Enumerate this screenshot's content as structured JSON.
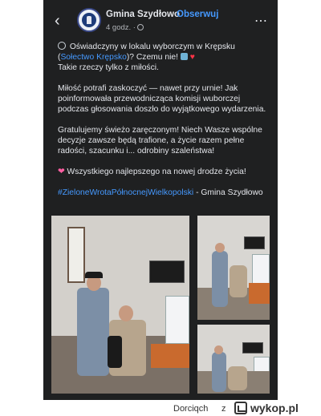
{
  "post": {
    "page_name": "Gmina Szydłowo",
    "separator": "·",
    "follow_label": "Obserwuj",
    "time": "4 godz. ·",
    "paragraphs": {
      "p1_a": " Oświadczyny w lokalu wyborczym w Krępsku (",
      "p1_link": "Sołectwo Krępsko",
      "p1_b": ")? Czemu nie! ",
      "p1_c": "Takie rzeczy tylko z miłości.",
      "p2": "Miłość potrafi zaskoczyć — nawet przy urnie! Jak poinformowała przewodnicząca komisji wuborczej podczas głosowania doszło do wyjątkowego wydarzenia.",
      "p3": "Gratulujemy świeżo zaręczonym! Niech Wasze wspólne decyzje zawsze będą trafione, a życie razem pełne radości, szacunku i... odrobiny szaleństwa!",
      "p4": " Wszystkiego najlepszego na nowej drodze życia!",
      "hashtag": "#ZieloneWrotaPółnocnejWielkopolski",
      "p5_tail": " - Gmina Szydłowo"
    }
  },
  "icons": {
    "back": "chevron-left-icon",
    "more": "more-dots-icon",
    "globe": "globe-icon",
    "ring": "ring-icon",
    "heart": "heart-icon",
    "hearts": "hearts-icon"
  },
  "colors": {
    "background": "#1f2021",
    "link": "#4599ff",
    "text": "#e4e6eb"
  },
  "footer": {
    "author": "Dorciqch",
    "sep": "z",
    "site": "wykop.pl"
  }
}
